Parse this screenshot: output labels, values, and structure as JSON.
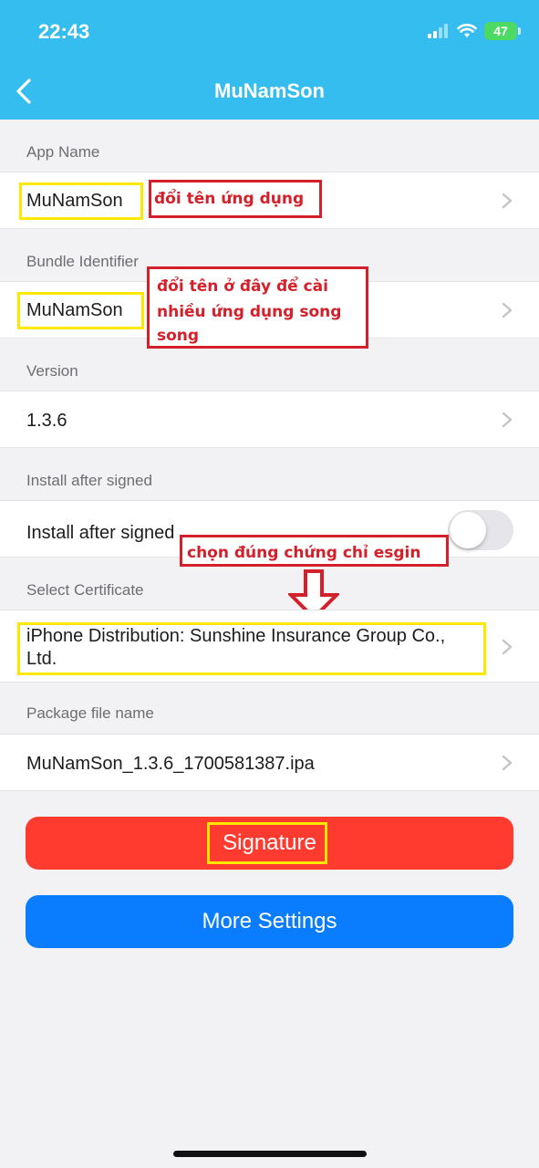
{
  "status_bar": {
    "time": "22:43",
    "battery": "47"
  },
  "nav": {
    "title": "MuNamSon"
  },
  "sections": {
    "app_name": {
      "label": "App Name",
      "value": "MuNamSon"
    },
    "bundle_id": {
      "label": "Bundle Identifier",
      "value": "MuNamSon"
    },
    "version": {
      "label": "Version",
      "value": "1.3.6"
    },
    "install": {
      "label": "Install after signed",
      "row_label": "Install after signed",
      "enabled": false
    },
    "certificate": {
      "label": "Select Certificate",
      "line1": "iPhone Distribution: Sunshine Insurance Group Co.,",
      "line2": "Ltd."
    },
    "package": {
      "label": "Package file name",
      "value": "MuNamSon_1.3.6_1700581387.ipa"
    }
  },
  "buttons": {
    "signature": "Signature",
    "more_settings": "More Settings"
  },
  "annotations": {
    "rename_app": "đổi tên ứng dụng",
    "rename_bundle": [
      "đổi tên ở đây để cài",
      "nhiều ứng dụng song",
      "song"
    ],
    "choose_cert": "chọn đúng chứng chỉ esgin"
  },
  "colors": {
    "header": "#35bdf0",
    "signature_button": "#ff3b30",
    "more_settings_button": "#0a7dff",
    "highlight_yellow": "#ffe800",
    "annotation_red": "#d4202a"
  },
  "icons": [
    "back-chevron-icon",
    "chevron-right-icon",
    "signal-icon",
    "wifi-icon",
    "battery-icon",
    "down-arrow-icon"
  ]
}
